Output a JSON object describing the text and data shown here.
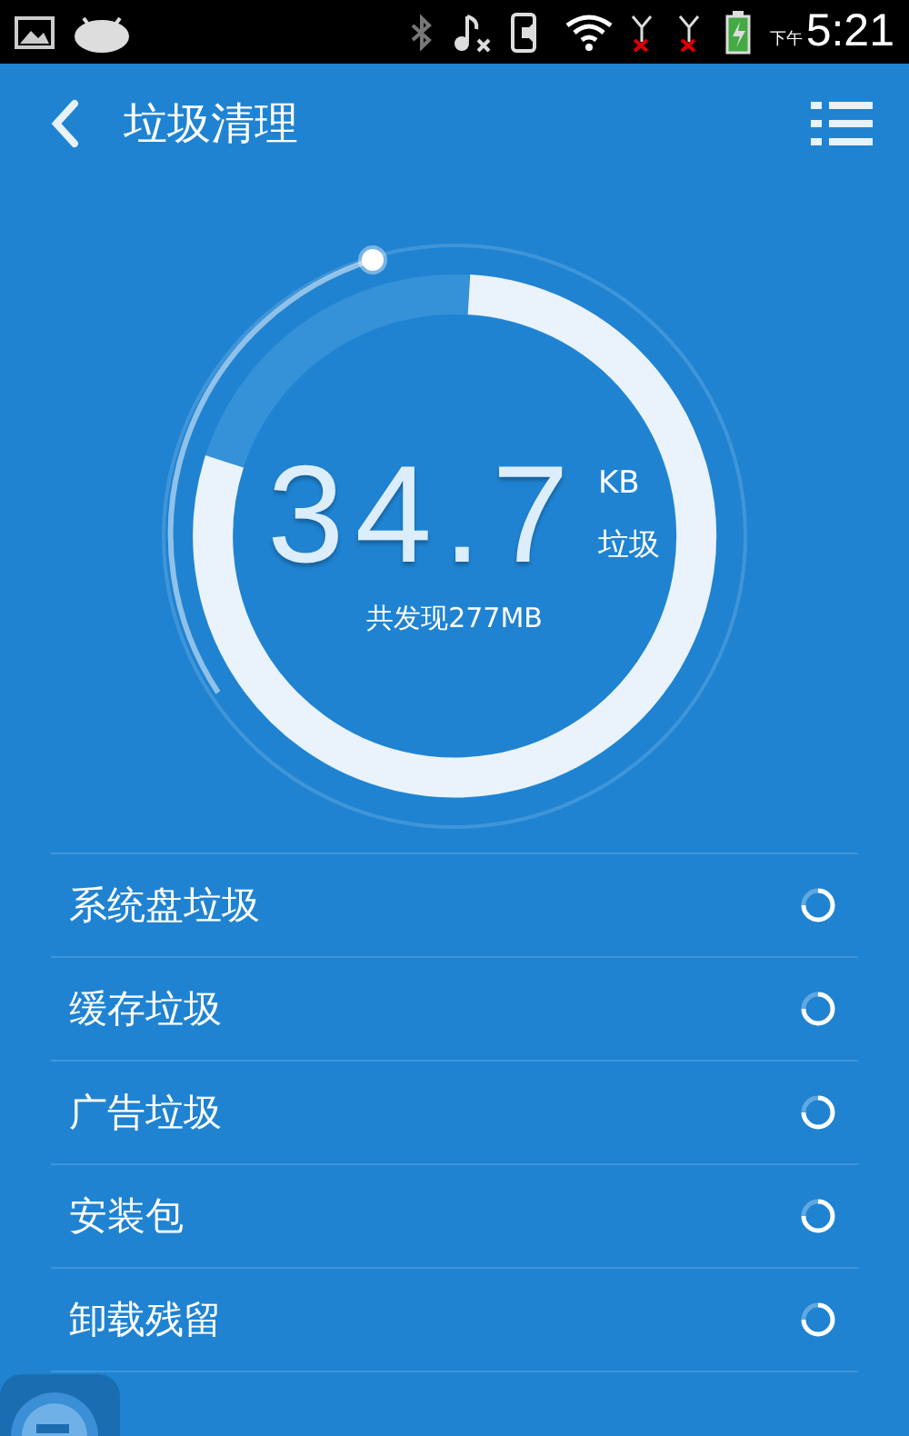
{
  "status_bar": {
    "time": "5:21",
    "period": "下午"
  },
  "header": {
    "title": "垃圾清理"
  },
  "gauge": {
    "value": "34.7",
    "unit": "KB",
    "unit_label": "垃圾",
    "summary": "共发现277MB"
  },
  "items": [
    {
      "label": "系统盘垃圾",
      "scanning": true
    },
    {
      "label": "缓存垃圾",
      "scanning": true
    },
    {
      "label": "广告垃圾",
      "scanning": true
    },
    {
      "label": "安装包",
      "scanning": true
    },
    {
      "label": "卸载残留",
      "scanning": true
    }
  ]
}
